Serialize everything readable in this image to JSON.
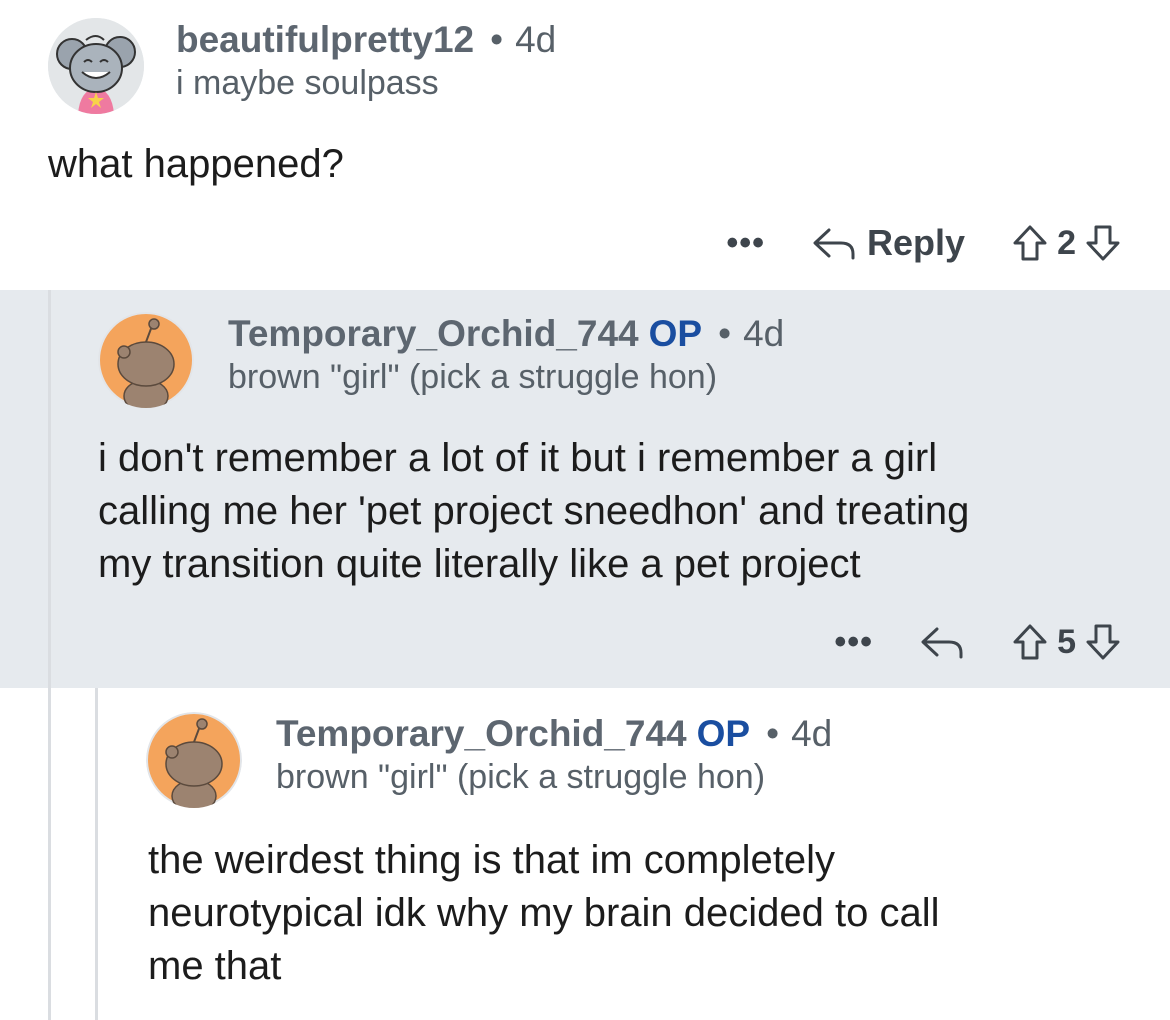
{
  "comments": [
    {
      "username": "beautifulpretty12",
      "op": "",
      "separator": "•",
      "age": "4d",
      "flair": "i maybe soulpass",
      "body": "what happened?",
      "more": "•••",
      "reply_label": "Reply",
      "score": "2"
    },
    {
      "username": "Temporary_Orchid_744",
      "op": "OP",
      "separator": "•",
      "age": "4d",
      "flair": "brown \"girl\" (pick a struggle hon)",
      "body_lines": [
        "i don't remember a lot of it but i remember a girl",
        "calling me her 'pet project sneedhon' and treating",
        "my transition quite literally like a pet project"
      ],
      "more": "•••",
      "score": "5"
    },
    {
      "username": "Temporary_Orchid_744",
      "op": "OP",
      "separator": "•",
      "age": "4d",
      "flair": "brown \"girl\" (pick a struggle hon)",
      "body_lines": [
        "the weirdest thing is that im completely",
        "neurotypical idk why my brain decided to call",
        "me that"
      ]
    }
  ],
  "icons": {
    "reply": "reply-arrow-icon",
    "upvote": "upvote-arrow-icon",
    "downvote": "downvote-arrow-icon",
    "more": "more-options-icon"
  },
  "colors": {
    "op_badge": "#1a4ea0",
    "highlight_bg": "#e6eaee",
    "avatar_orange": "#f4a45c",
    "snoo_brown": "#9c8370"
  }
}
